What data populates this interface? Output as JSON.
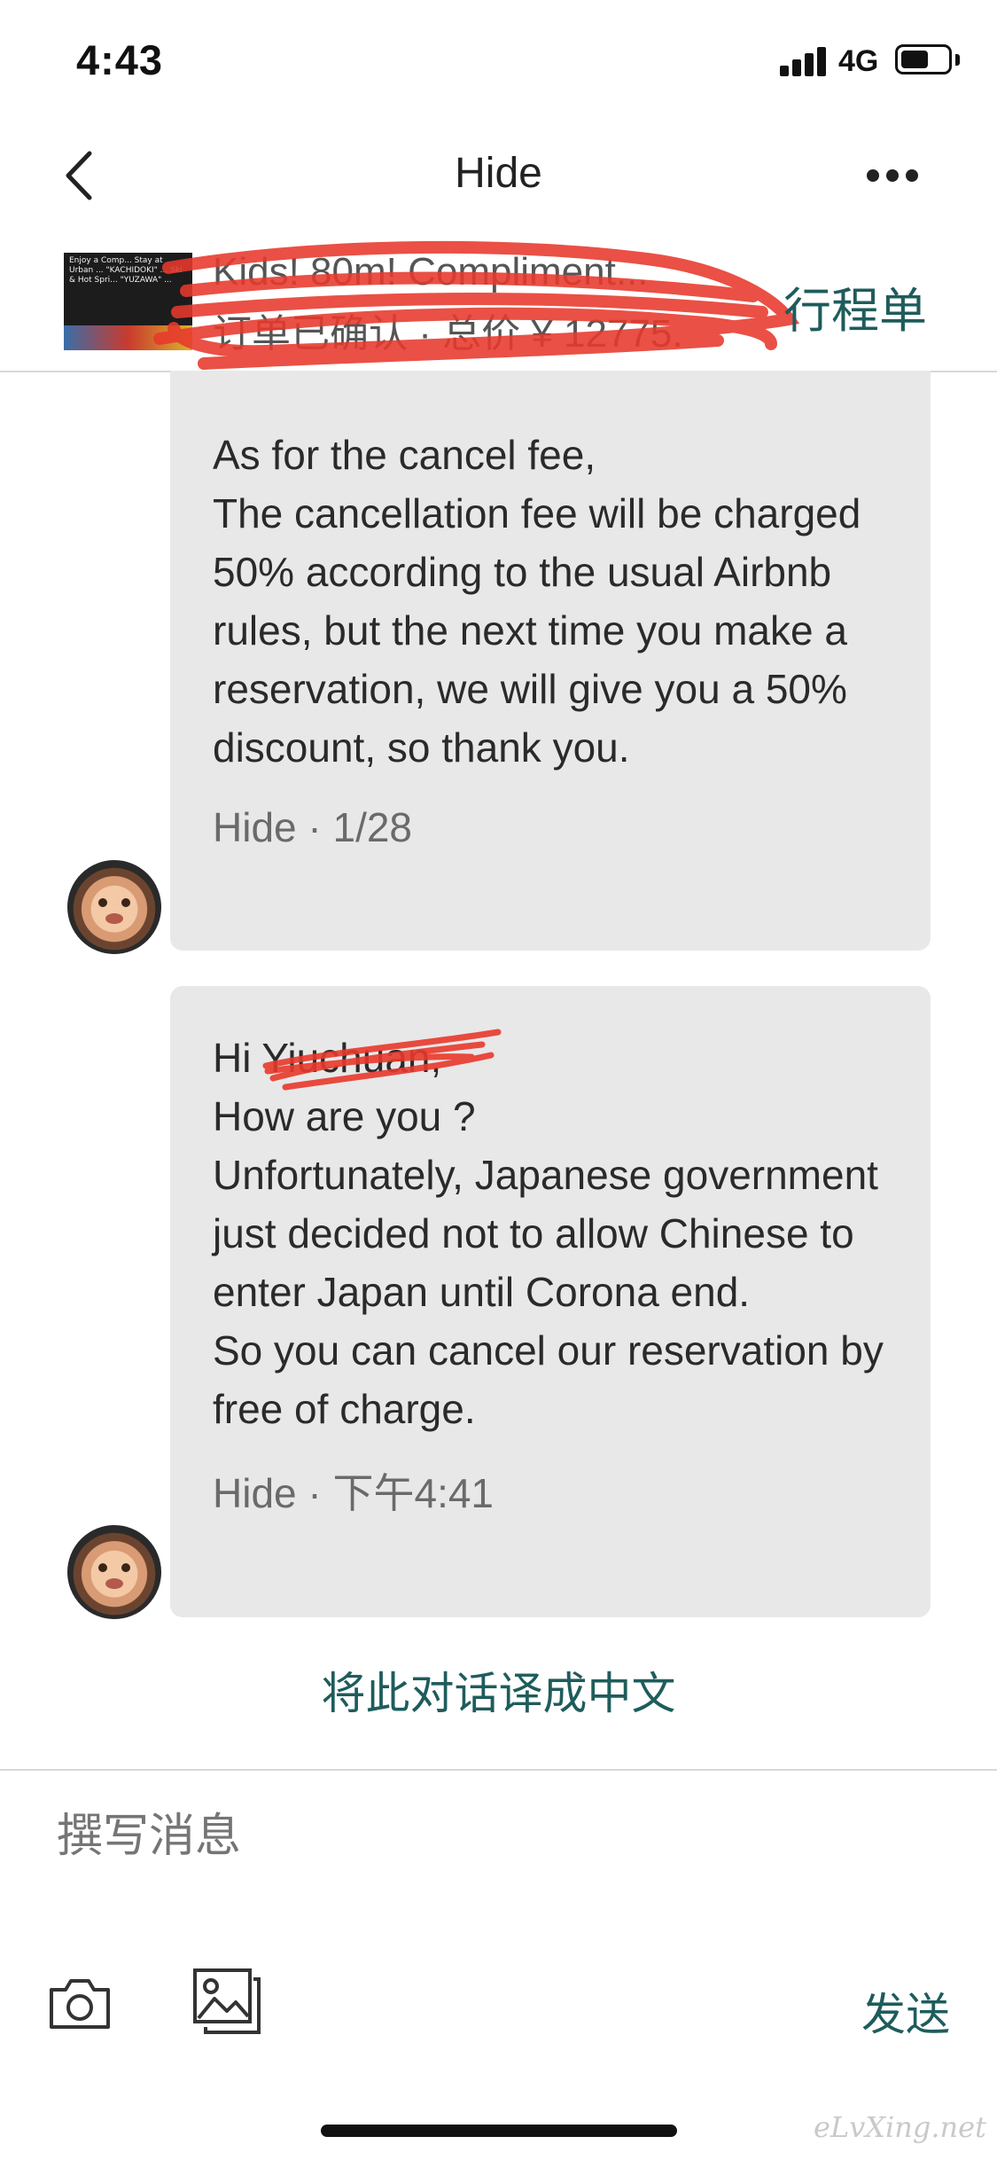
{
  "status_bar": {
    "time": "4:43",
    "network": "4G"
  },
  "nav": {
    "title": "Hide"
  },
  "listing": {
    "title": "Kids! 80m! Compliment...",
    "subtitle": "订单已确认 · 总价 ¥ 12775.",
    "itinerary_label": "行程单",
    "thumb_text": "Enjoy a Comp... Stay at Urban ... \"KACHIDOKI\" ... Ski & Hot Spri... \"YUZAWA\" ..."
  },
  "messages": [
    {
      "text": "As for the cancel fee,\nThe cancellation fee will be charged 50% according to the usual Airbnb rules, but the next time you make a reservation, we will give you a 50% discount, so thank you.",
      "meta": "Hide · 1/28"
    },
    {
      "text": "Hi Yiuchuan,\nHow are you ?\nUnfortunately, Japanese government just  decided not to allow Chinese to enter Japan until Corona end.\nSo you can cancel our reservation by free of charge.",
      "meta": "Hide · 下午4:41"
    }
  ],
  "translate_link": "将此对话译成中文",
  "composer": {
    "placeholder": "撰写消息",
    "send_label": "发送"
  },
  "watermark": "eLvXing.net",
  "colors": {
    "accent": "#1f5c5c",
    "bubble": "#e8e8e8",
    "redaction": "#e8392c"
  }
}
